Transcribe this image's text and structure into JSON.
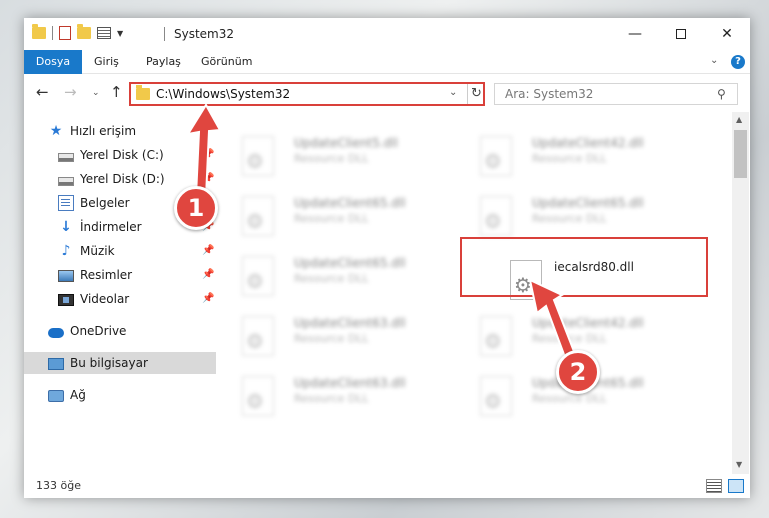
{
  "window": {
    "title": "System32",
    "controls": {
      "minimize": "—",
      "maximize": "",
      "close": "✕"
    }
  },
  "ribbon": {
    "tabs": [
      "Dosya",
      "Giriş",
      "Paylaş",
      "Görünüm"
    ],
    "help": "?"
  },
  "navigation": {
    "address": "C:\\Windows\\System32",
    "search_placeholder": "Ara: System32"
  },
  "sidebar": {
    "items": [
      {
        "label": "Hızlı erişim",
        "icon": "star-icon"
      },
      {
        "label": "Yerel Disk (C:)",
        "icon": "drive-icon"
      },
      {
        "label": "Yerel Disk (D:)",
        "icon": "drive-icon"
      },
      {
        "label": "Belgeler",
        "icon": "document-icon"
      },
      {
        "label": "İndirmeler",
        "icon": "download-icon"
      },
      {
        "label": "Müzik",
        "icon": "music-icon"
      },
      {
        "label": "Resimler",
        "icon": "pictures-icon"
      },
      {
        "label": "Videolar",
        "icon": "video-icon"
      },
      {
        "label": "OneDrive",
        "icon": "cloud-icon"
      },
      {
        "label": "Bu bilgisayar",
        "icon": "computer-icon"
      },
      {
        "label": "Ağ",
        "icon": "network-icon"
      }
    ]
  },
  "files": [
    {
      "name": "UpdateClient5.dll",
      "desc": "Resource DLL"
    },
    {
      "name": "UpdateClient42.dll",
      "desc": "Resource DLL"
    },
    {
      "name": "UpdateClient65.dll",
      "desc": "Resource DLL"
    },
    {
      "name": "UpdateClient65.dll",
      "desc": "Resource DLL"
    },
    {
      "name": "UpdateClient65.dll",
      "desc": "Resource DLL"
    },
    {
      "name": "iecalsrd80.dll",
      "desc": ""
    },
    {
      "name": "UpdateClient63.dll",
      "desc": "Resource DLL"
    },
    {
      "name": "UpdateClient42.dll",
      "desc": "Resource DLL"
    },
    {
      "name": "UpdateClient63.dll",
      "desc": "Resource DLL"
    },
    {
      "name": "UpdateClient65.dll",
      "desc": "Resource DLL"
    }
  ],
  "status": {
    "count": "133 öğe"
  },
  "annotations": {
    "step1": "1",
    "step2": "2",
    "color": "#d9403a"
  }
}
